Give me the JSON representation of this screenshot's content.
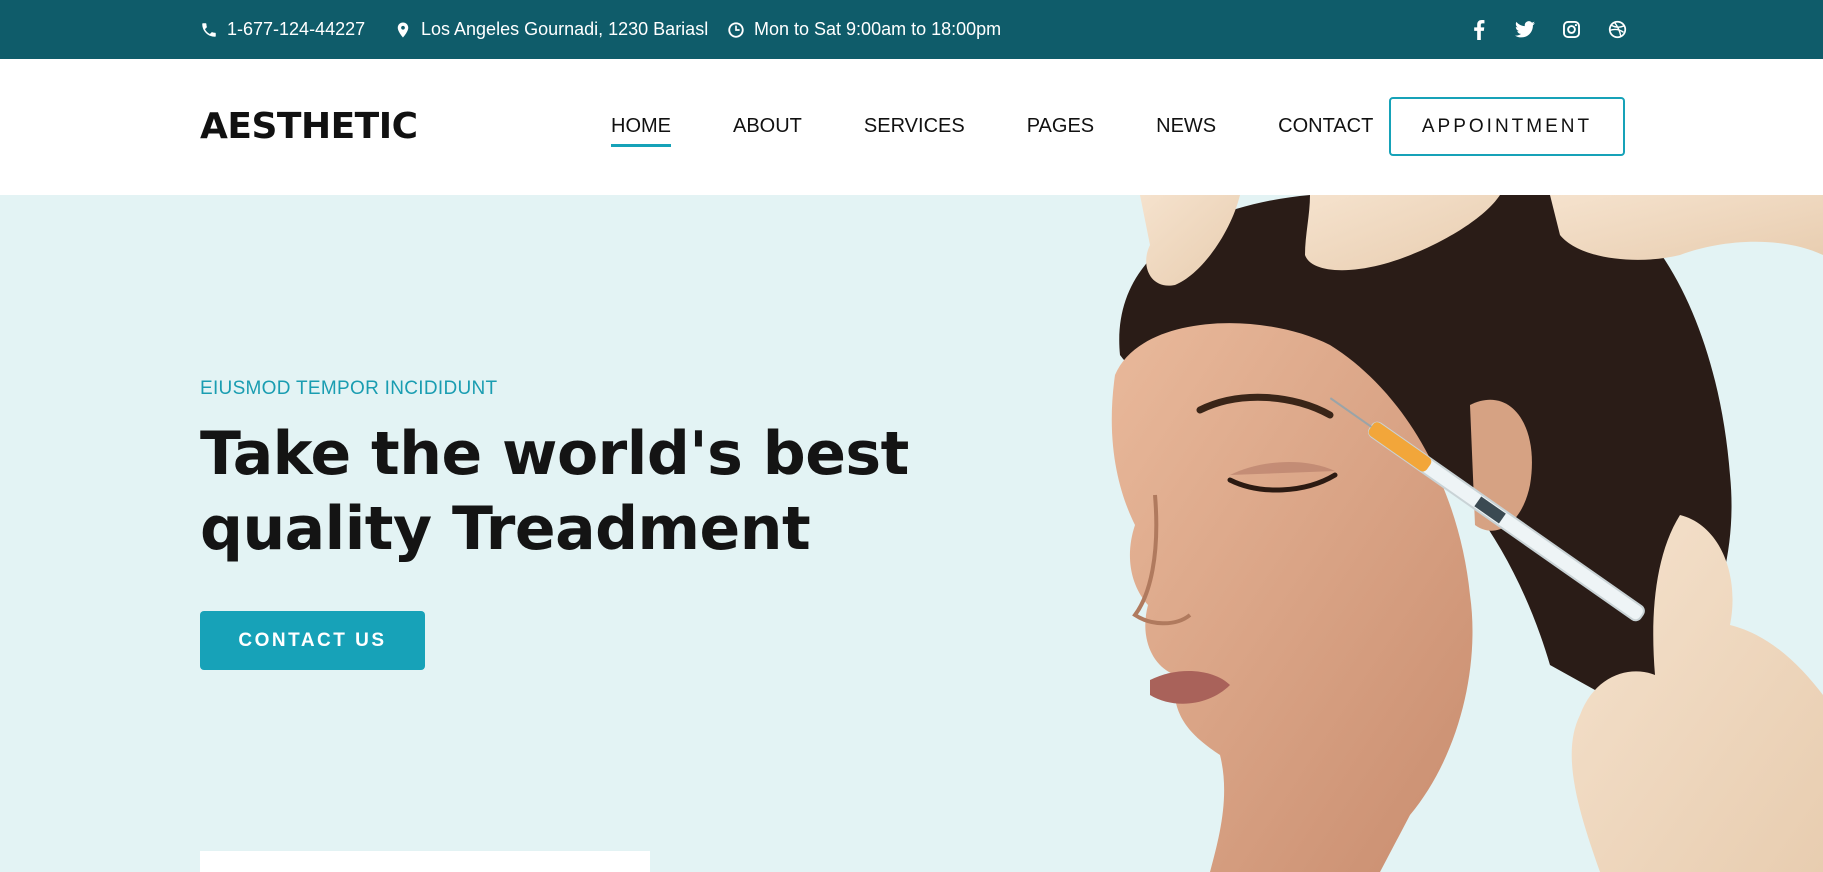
{
  "topbar": {
    "phone": "1-677-124-44227",
    "address": "Los Angeles Gournadi, 1230 Bariasl",
    "hours": "Mon to Sat 9:00am to 18:00pm",
    "icons": [
      "phone-icon",
      "map-pin-icon",
      "clock-icon"
    ],
    "social": [
      "facebook-icon",
      "twitter-icon",
      "instagram-icon",
      "dribbble-icon"
    ]
  },
  "header": {
    "logo": "AESTHETIC",
    "nav": [
      "HOME",
      "ABOUT",
      "SERVICES",
      "PAGES",
      "NEWS",
      "CONTACT"
    ],
    "active_nav": "HOME",
    "appointment": "APPOINTMENT"
  },
  "hero": {
    "eyebrow": "EIUSMOD TEMPOR INCIDIDUNT",
    "headline_line1": "Take the world's best",
    "headline_line2": "quality Treadment",
    "cta": "CONTACT US"
  },
  "colors": {
    "topbar_bg": "#0f5c6a",
    "accent": "#16a2b8",
    "hero_bg": "#e3f3f4",
    "text_dark": "#111111"
  }
}
